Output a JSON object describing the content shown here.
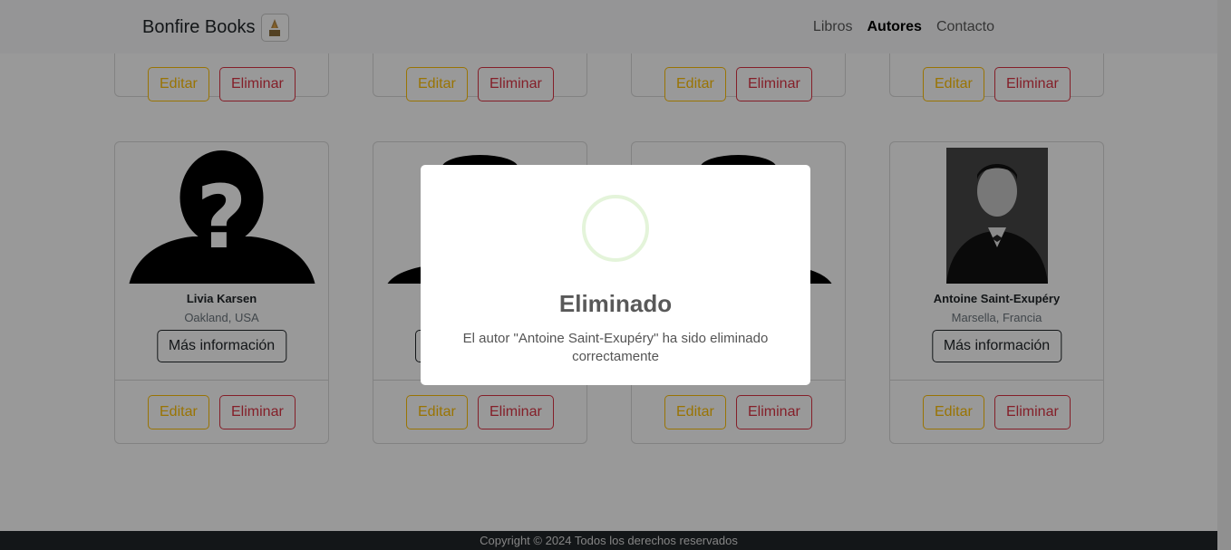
{
  "navbar": {
    "brand": "Bonfire Books",
    "links": [
      "Libros",
      "Autores",
      "Contacto"
    ],
    "active_link": "Autores"
  },
  "buttons": {
    "edit": "Editar",
    "delete": "Eliminar",
    "more_info": "Más información"
  },
  "authors": [
    {
      "name": "Livia Karsen",
      "location": "Oakland, USA",
      "photo": "unknown-silhouette"
    },
    {
      "name": "",
      "location": "",
      "photo": "hat-silhouette"
    },
    {
      "name": "",
      "location": "",
      "photo": "hat-silhouette"
    },
    {
      "name": "Antoine Saint-Exupéry",
      "location": "Marsella, Francia",
      "photo": "portrait-photo"
    }
  ],
  "modal": {
    "title": "Eliminado",
    "message": "El autor \"Antoine Saint-Exupéry\" ha sido eliminado correctamente",
    "icon": "success-icon"
  },
  "footer": {
    "copyright": "Copyright © 2024 Todos los derechos reservados"
  },
  "colors": {
    "edit": "#ffc107",
    "delete": "#dc3545",
    "overlay": "rgba(0,0,0,0.4)"
  }
}
